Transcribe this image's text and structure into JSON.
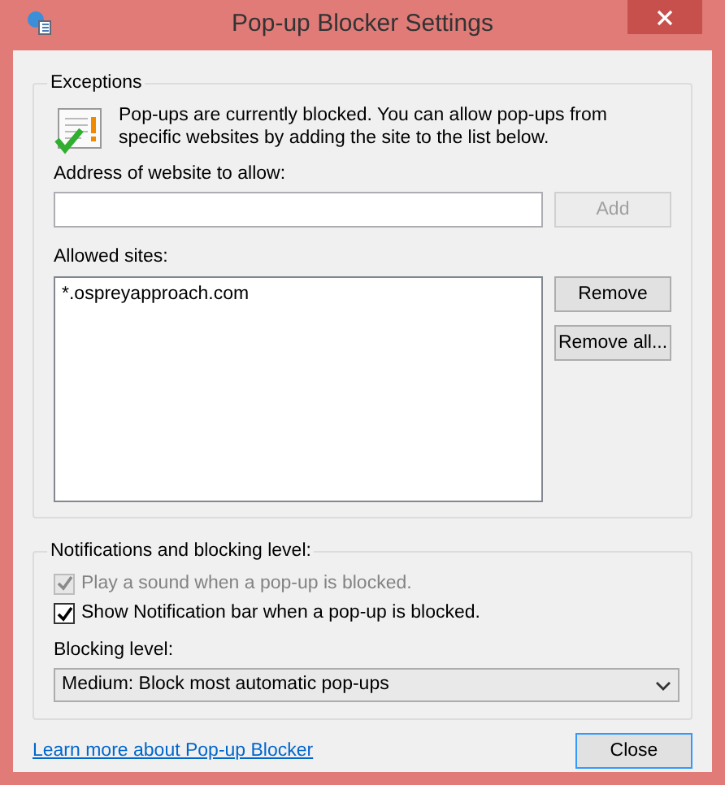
{
  "window": {
    "title": "Pop-up Blocker Settings"
  },
  "exceptions": {
    "legend": "Exceptions",
    "message": "Pop-ups are currently blocked.  You can allow pop-ups from specific websites by adding the site to the list below.",
    "address_label": "Address of website to allow:",
    "add_button": {
      "label": "Add",
      "disabled": true
    },
    "allowed_label": "Allowed sites:",
    "sites": [
      {
        "text": "*.ospreyapproach.com"
      }
    ],
    "buttons": [
      {
        "label": "Remove",
        "disabled": false
      },
      {
        "label": "Remove all...",
        "disabled": false
      }
    ]
  },
  "notifications": {
    "legend": "Notifications and blocking level:",
    "options": [
      {
        "label": "Play a sound when a pop-up is blocked.",
        "checked": true,
        "disabled": true
      },
      {
        "label": "Show Notification bar when a pop-up is blocked.",
        "checked": true,
        "disabled": false
      }
    ],
    "level_label": "Blocking level:",
    "level_value": "Medium: Block most automatic pop-ups"
  },
  "footer": {
    "link": "Learn more about Pop-up Blocker",
    "close_button": "Close"
  }
}
